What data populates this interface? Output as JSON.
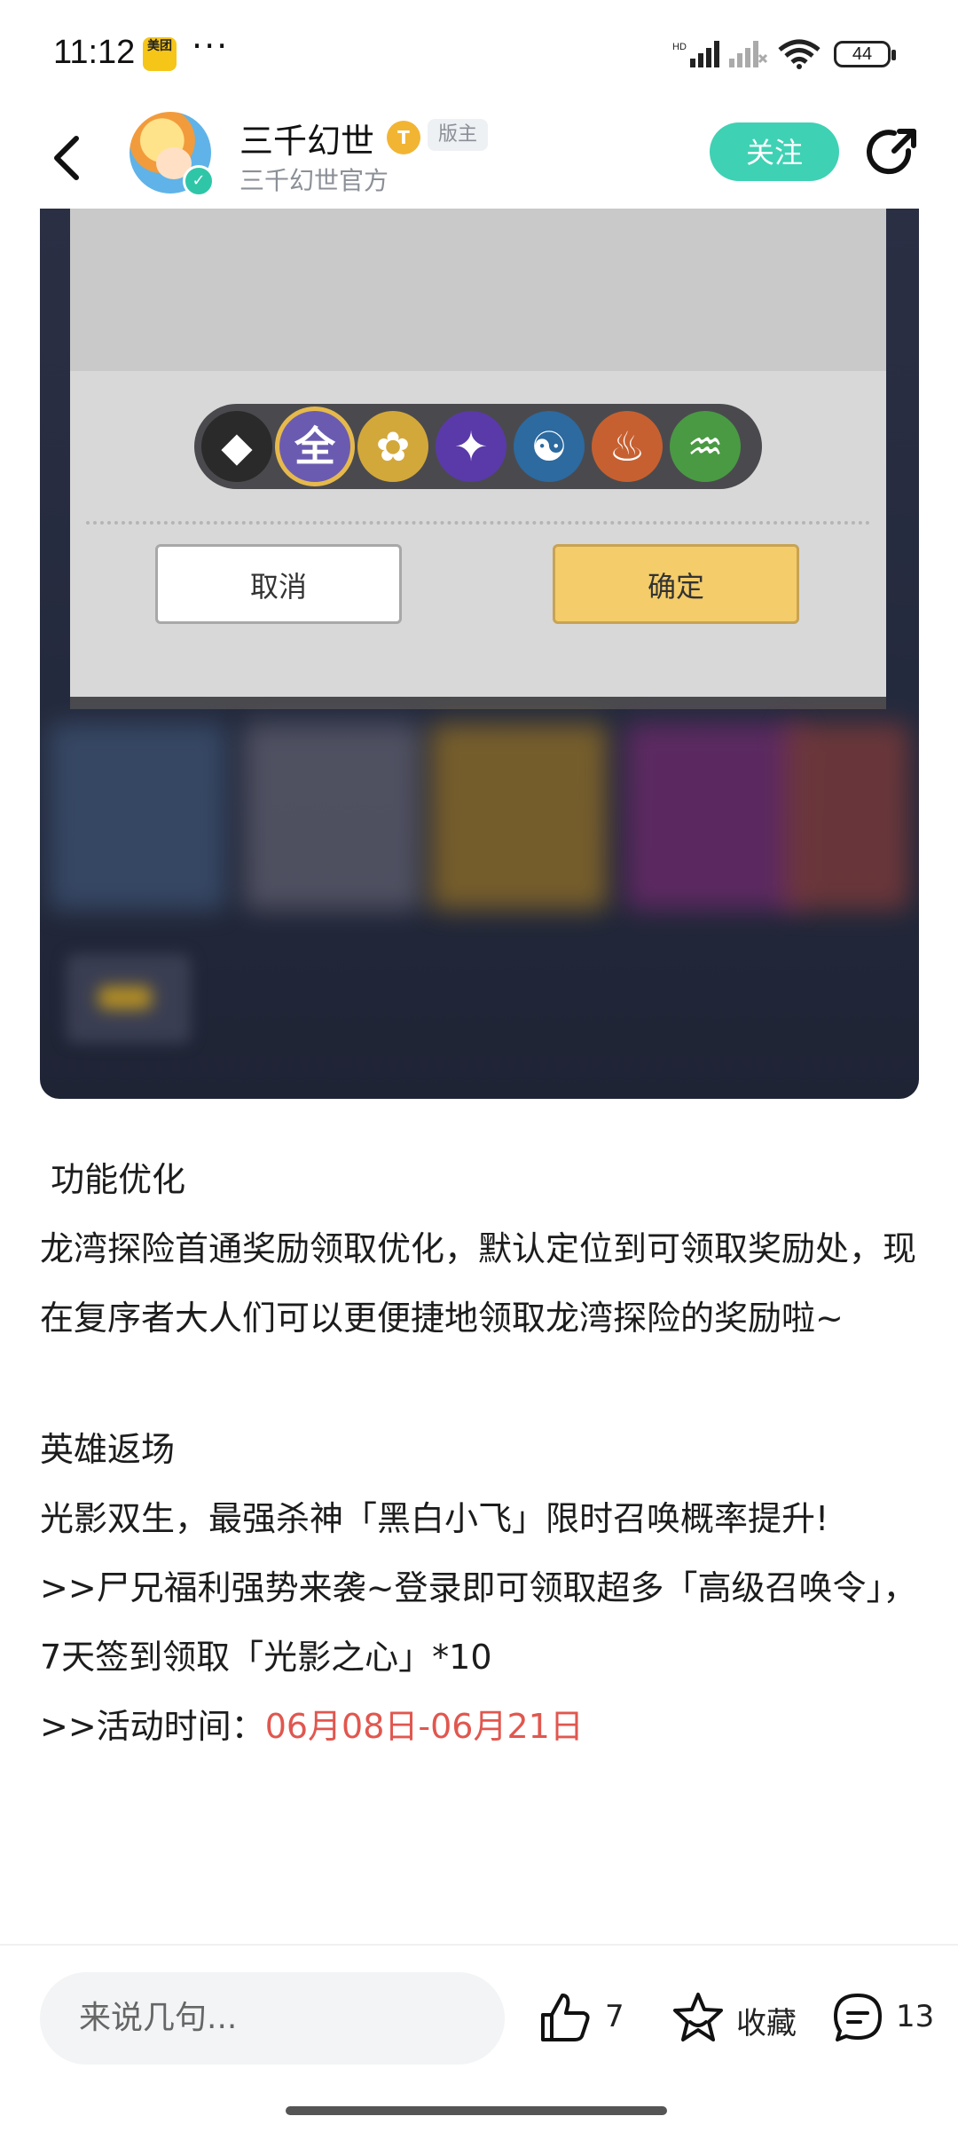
{
  "status_bar": {
    "time": "11:12",
    "app_badge": "美团",
    "more": "···",
    "battery": "44"
  },
  "header": {
    "username": "三千幻世",
    "level_badge": "T",
    "role_badge": "版主",
    "subtitle": "三千幻世官方",
    "follow_label": "关注"
  },
  "screenshot": {
    "element_icons": [
      "◆",
      "全",
      "✿",
      "✦",
      "☯",
      "♨",
      "♒"
    ],
    "element_colors": [
      "#2a2a2a",
      "#6b5bb0",
      "#d3a83a",
      "#5a3aa8",
      "#2c6aa0",
      "#c76030",
      "#4a9a44"
    ],
    "cancel_label": "取消",
    "confirm_label": "确定"
  },
  "article": {
    "section1_title": " 功能优化",
    "section1_body": "龙湾探险首通奖励领取优化，默认定位到可领取奖励处，现在复序者大人们可以更便捷地领取龙湾探险的奖励啦~",
    "section2_title": "英雄返场",
    "section2_line1": "光影双生，最强杀神「黑白小飞」限时召唤概率提升!",
    "section2_line2": ">>尸兄福利强势来袭~登录即可领取超多「高级召唤令」，7天签到领取「光影之心」*10",
    "section2_time_label": ">>活动时间：",
    "section2_time_value": "06月08日-06月21日"
  },
  "bottom_bar": {
    "comment_placeholder": "来说几句...",
    "like_count": "7",
    "favorite_label": "收藏",
    "comment_count": "13"
  },
  "colors": {
    "accent": "#3fd1b4",
    "highlight_red": "#e0574f"
  }
}
